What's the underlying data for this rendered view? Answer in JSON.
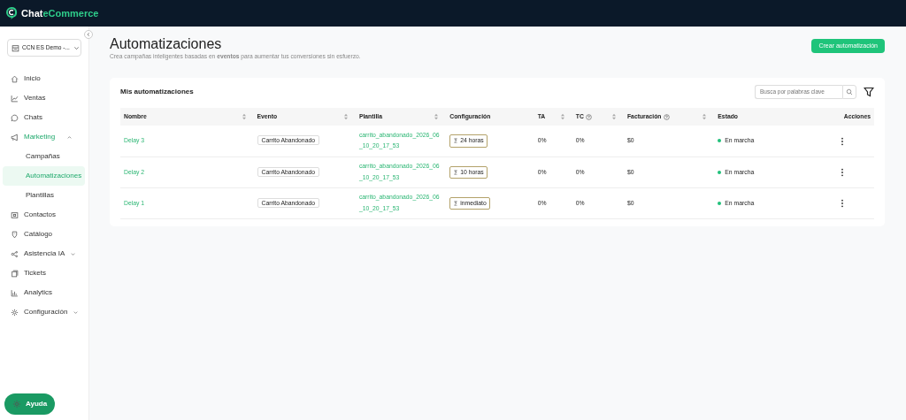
{
  "brand": {
    "first": "Chat",
    "second": "eCommerce"
  },
  "sidebar": {
    "account": "CCN ES Demo -...",
    "items": [
      {
        "label": "Inicio"
      },
      {
        "label": "Ventas"
      },
      {
        "label": "Chats"
      },
      {
        "label": "Marketing",
        "expanded": true,
        "children": [
          {
            "label": "Campañas",
            "selected": false
          },
          {
            "label": "Automatizaciones",
            "selected": true
          },
          {
            "label": "Plantillas",
            "selected": false
          }
        ]
      },
      {
        "label": "Contactos"
      },
      {
        "label": "Catálogo"
      },
      {
        "label": "Asistencia IA",
        "expanded": false
      },
      {
        "label": "Tickets"
      },
      {
        "label": "Analytics"
      },
      {
        "label": "Configuración",
        "expanded": false
      }
    ],
    "help_button": "Ayuda"
  },
  "page": {
    "title": "Automatizaciones",
    "subtitle": "Crea campañas inteligentes basadas en **eventos** para aumentar tus conversiones sin esfuerzo.",
    "create_button": "Crear automatización"
  },
  "card": {
    "title": "Mis automatizaciones",
    "search": {
      "placeholder": "Busca por palabras clave"
    },
    "table": {
      "columns": [
        {
          "label": "Nombre",
          "sortable": true,
          "help": false
        },
        {
          "label": "Evento",
          "sortable": true,
          "help": false
        },
        {
          "label": "Plantilla",
          "sortable": true,
          "help": false
        },
        {
          "label": "Configuración",
          "sortable": false,
          "help": false
        },
        {
          "label": "TA",
          "sortable": true,
          "help": false
        },
        {
          "label": "TC",
          "sortable": true,
          "help": true
        },
        {
          "label": "Facturación",
          "sortable": true,
          "help": true
        },
        {
          "label": "Estado",
          "sortable": false,
          "help": false
        },
        {
          "label": "Acciones",
          "sortable": false,
          "help": false
        }
      ],
      "rows": [
        {
          "name": "Delay 3",
          "event": "Carrito Abandonado",
          "template": "carrito_abandonado_2026_06_10_20_17_53",
          "config": "24 horas",
          "ta": "0%",
          "tc": "0%",
          "billing": "$0",
          "status": "En marcha",
          "color": "#20c07a"
        },
        {
          "name": "Delay 2",
          "event": "Carrito Abandonado",
          "template": "carrito_abandonado_2026_06_10_20_17_53",
          "config": "10 horas",
          "ta": "0%",
          "tc": "0%",
          "billing": "$0",
          "status": "En marcha",
          "color": "#20c07a"
        },
        {
          "name": "Delay 1",
          "event": "Carrito Abandonado",
          "template": "carrito_abandonado_2026_06_10_20_17_53",
          "config": "inmediato",
          "ta": "0%",
          "tc": "0%",
          "billing": "$0",
          "status": "En marcha",
          "color": "#20c07a"
        }
      ]
    }
  }
}
